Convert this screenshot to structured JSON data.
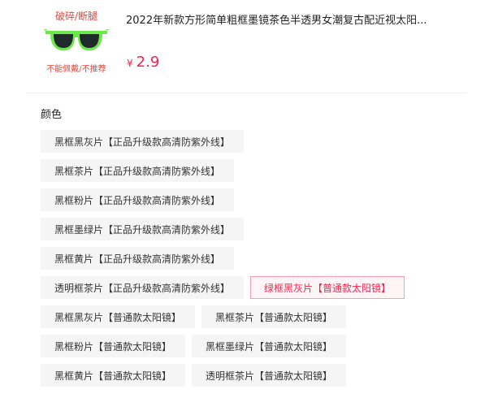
{
  "product": {
    "thumb_top_text": "破碎/断腿",
    "thumb_bottom_text": "不能佩戴/不推荐",
    "title": "2022年新款方形简单粗框墨镜茶色半透男女潮复古配近视太阳...",
    "currency": "¥",
    "price": "2.9"
  },
  "colors": {
    "accent": "#ff1e4a",
    "frame": "#6be84a",
    "lens": "#1f2a2a"
  },
  "section": {
    "label": "颜色"
  },
  "options": [
    [
      "黑框黑灰片【正品升级款高清防紫外线】"
    ],
    [
      "黑框茶片【正品升级款高清防紫外线】"
    ],
    [
      "黑框粉片【正品升级款高清防紫外线】"
    ],
    [
      "黑框墨绿片【正品升级款高清防紫外线】"
    ],
    [
      "黑框黄片【正品升级款高清防紫外线】"
    ],
    [
      "透明框茶片【正品升级款高清防紫外线】",
      "绿框黑灰片【普通款太阳镜】"
    ],
    [
      "黑框黑灰片【普通款太阳镜】",
      "黑框茶片【普通款太阳镜】"
    ],
    [
      "黑框粉片【普通款太阳镜】",
      "黑框墨绿片【普通款太阳镜】"
    ],
    [
      "黑框黄片【普通款太阳镜】",
      "透明框茶片【普通款太阳镜】"
    ]
  ],
  "selected_option": "绿框黑灰片【普通款太阳镜】"
}
